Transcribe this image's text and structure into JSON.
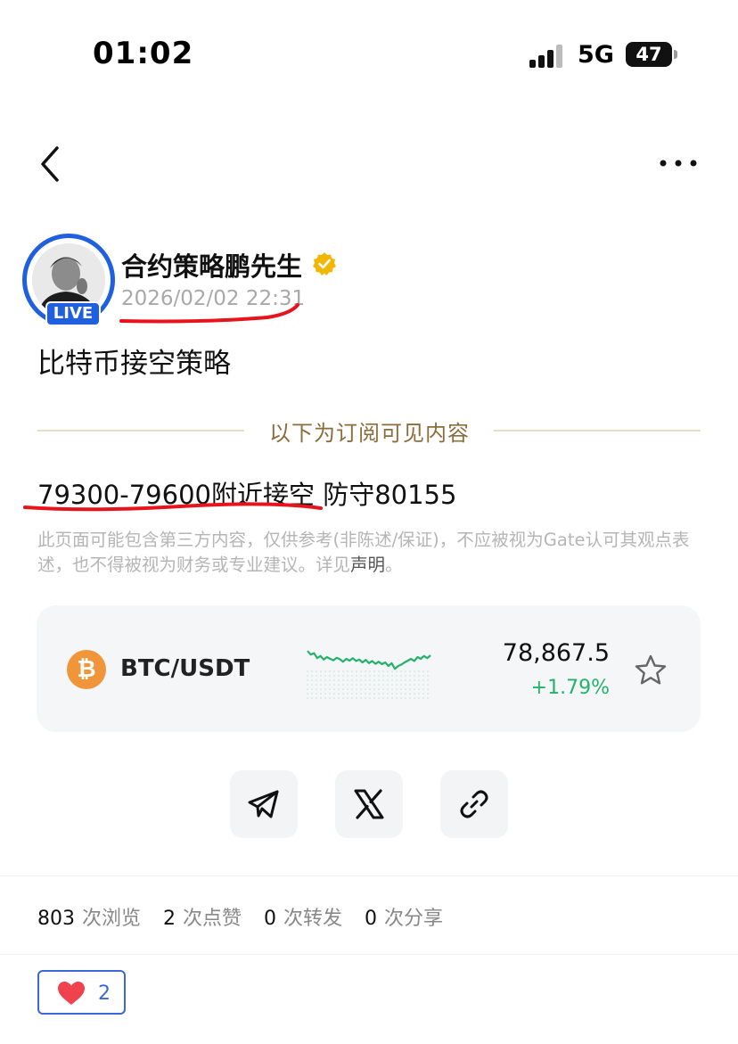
{
  "status_bar": {
    "time": "01:02",
    "network": "5G",
    "battery": "47"
  },
  "nav": {
    "back_icon": "chevron-left-icon",
    "more_icon": "more-horizontal-icon"
  },
  "author": {
    "name": "合约策略鹏先生",
    "live_badge": "LIVE",
    "post_time": "2026/02/02 22:31",
    "verified_color": "#f2b705",
    "ring_color": "#1f5fe0"
  },
  "post": {
    "title": "比特币接空策略",
    "subscribe_divider": "以下为订阅可见内容",
    "strategy_text": "79300-79600附近接空 防守80155",
    "disclaimer_text": "此页面可能包含第三方内容，仅供参考(非陈述/保证)，不应被视为Gate认可其观点表述，也不得被视为财务或专业建议。详见",
    "disclaimer_link": "声明",
    "disclaimer_end": "。"
  },
  "ticker": {
    "icon_symbol": "₿",
    "pair": "BTC/USDT",
    "price": "78,867.5",
    "change": "+1.79%",
    "change_color": "#24b26b",
    "sparkline": [
      0.72,
      0.62,
      0.66,
      0.52,
      0.58,
      0.48,
      0.55,
      0.5,
      0.46,
      0.53,
      0.49,
      0.42,
      0.5,
      0.45,
      0.52,
      0.44,
      0.48,
      0.4,
      0.47,
      0.38,
      0.44,
      0.36,
      0.42,
      0.35,
      0.4,
      0.3,
      0.38,
      0.22,
      0.3,
      0.34,
      0.4,
      0.45,
      0.5,
      0.44,
      0.55,
      0.5,
      0.58,
      0.52,
      0.6
    ]
  },
  "share": {
    "telegram_icon": "telegram-icon",
    "x_icon": "x-icon",
    "link_icon": "link-icon"
  },
  "stats": {
    "views": "803",
    "views_label": "次浏览",
    "likes": "2",
    "likes_label": "次点赞",
    "reposts": "0",
    "reposts_label": "次转发",
    "shares": "0",
    "shares_label": "次分享"
  },
  "reaction": {
    "count": "2",
    "heart_color": "#f0414f"
  }
}
